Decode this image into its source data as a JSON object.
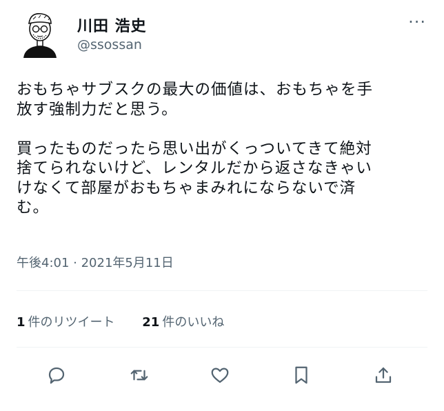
{
  "author": {
    "display_name": "川田 浩史",
    "handle": "@ssossan"
  },
  "more_label": "···",
  "tweet": {
    "text_line1": "おもちゃサブスクの最大の価値は、おもちゃを手\n放す強制力だと思う。",
    "text_line2": "買ったものだったら思い出がくっついてきて絶対\n捨てられないけど、レンタルだから返さなきゃい\nけなくて部屋がおもちゃまみれにならないで済\nむ。",
    "timestamp": "午後4:01 · 2021年5月11日"
  },
  "stats": {
    "retweet_count": "1",
    "retweet_label": "件のリツイート",
    "like_count": "21",
    "like_label": "件のいいね"
  },
  "icons": {
    "reply": "reply-icon",
    "retweet": "retweet-icon",
    "like": "heart-icon",
    "bookmark": "bookmark-icon",
    "share": "share-icon"
  },
  "colors": {
    "text": "#0f1419",
    "secondary": "#536471",
    "divider": "#eff3f4",
    "icon": "#536471"
  }
}
